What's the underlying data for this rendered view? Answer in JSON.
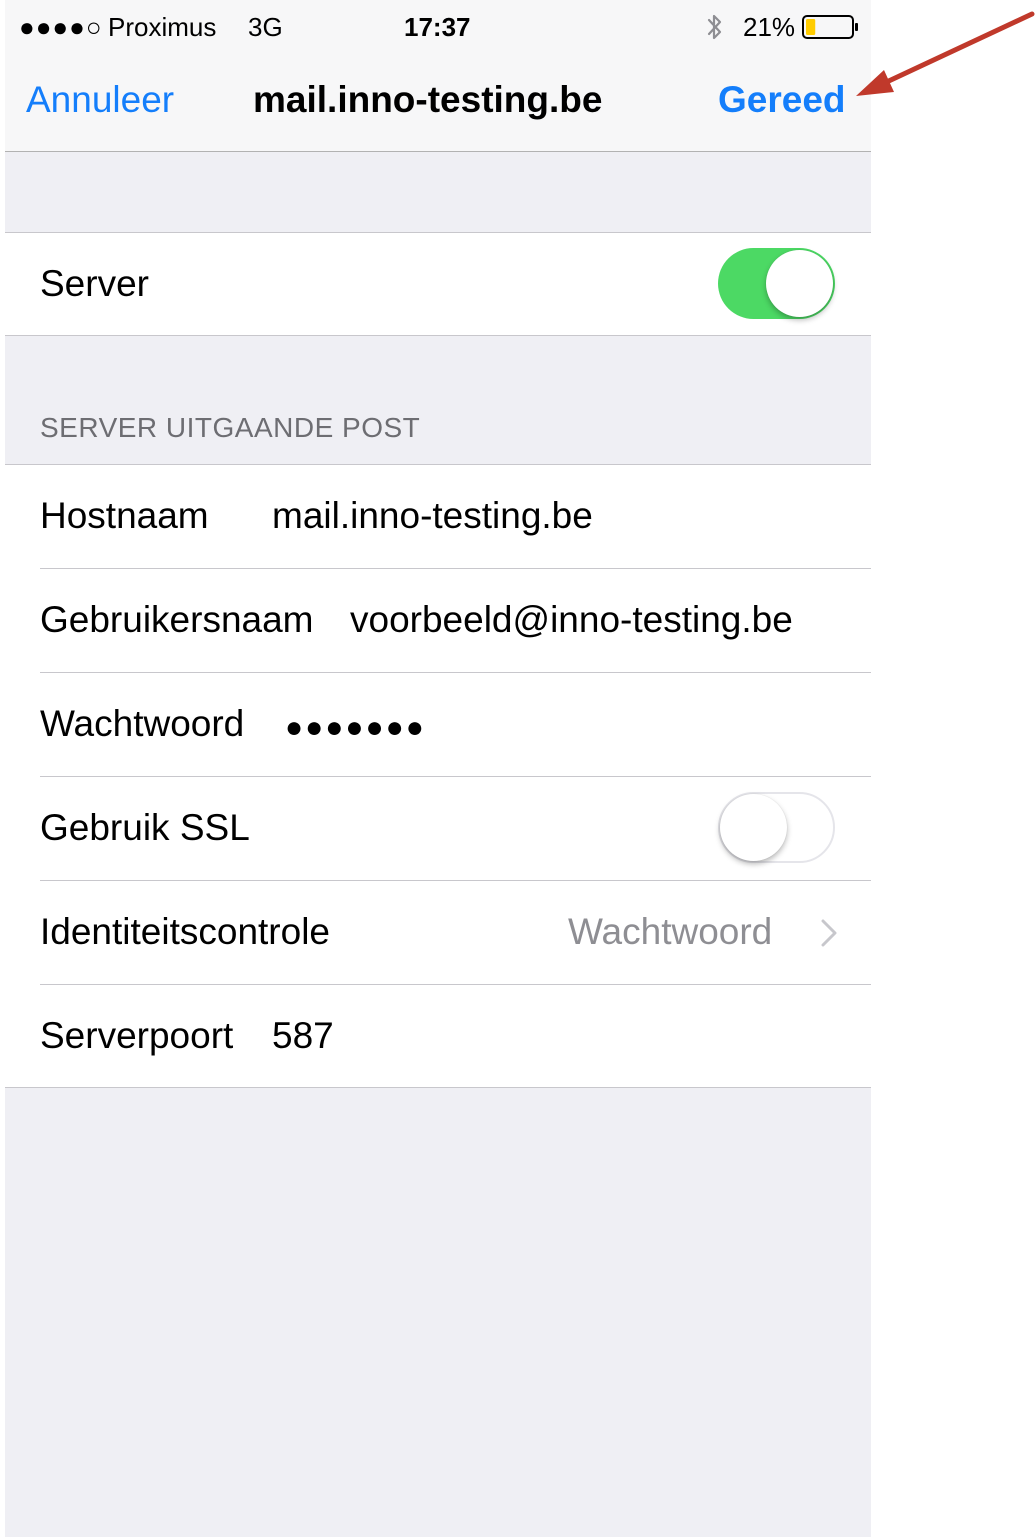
{
  "status_bar": {
    "signal": "●●●●○",
    "carrier": "Proximus",
    "network": "3G",
    "time": "17:37",
    "battery_percent": "21%",
    "battery_level": 0.21
  },
  "nav": {
    "cancel_label": "Annuleer",
    "title": "mail.inno-testing.be",
    "done_label": "Gereed"
  },
  "server_group": {
    "label": "Server",
    "enabled": true
  },
  "outgoing": {
    "header": "SERVER UITGAANDE POST",
    "hostname_label": "Hostnaam",
    "hostname_value": "mail.inno-testing.be",
    "username_label": "Gebruikersnaam",
    "username_value": "voorbeeld@inno-testing.be",
    "password_label": "Wachtwoord",
    "password_value": "●●●●●●●",
    "ssl_label": "Gebruik SSL",
    "ssl_enabled": false,
    "auth_label": "Identiteitscontrole",
    "auth_value": "Wachtwoord",
    "port_label": "Serverpoort",
    "port_value": "587"
  },
  "colors": {
    "accent": "#147efb",
    "toggle_on": "#4cd964",
    "annotation_arrow": "#c0392b"
  },
  "icons": [
    "bluetooth-icon",
    "battery-icon",
    "chevron-right-icon",
    "annotation-arrow"
  ]
}
